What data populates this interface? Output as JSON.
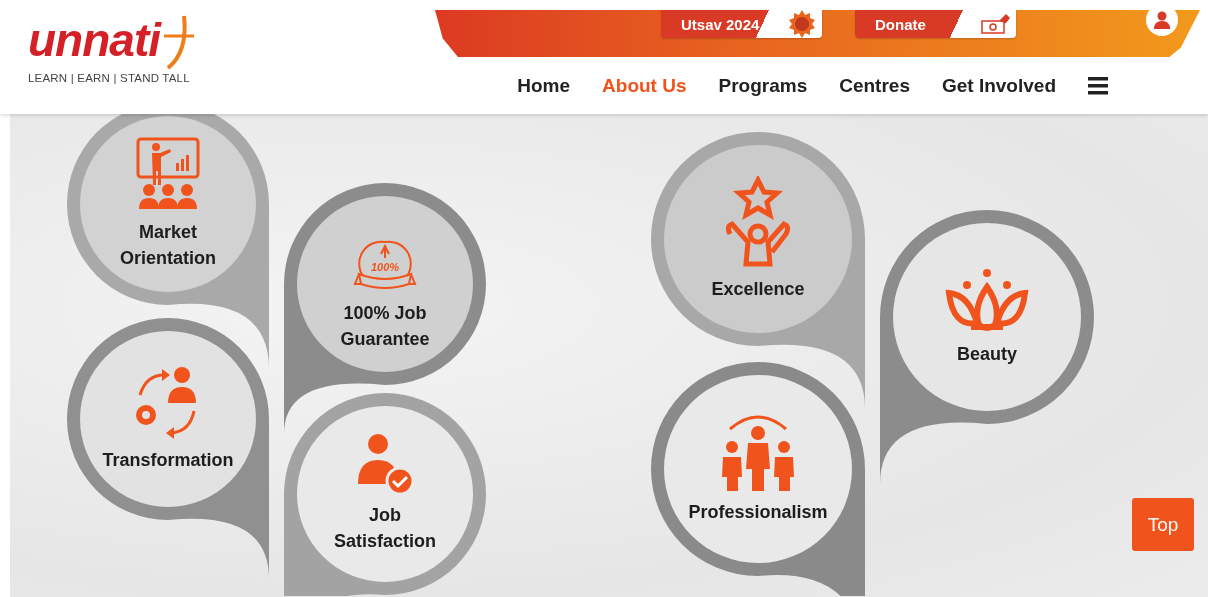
{
  "logo": {
    "wordmark": "unnati",
    "tagline": "LEARN | EARN | STAND TALL"
  },
  "top_bar": {
    "buttons": [
      {
        "label": "Utsav 2024",
        "kind": "badge"
      },
      {
        "label": "Donate",
        "kind": "money"
      }
    ]
  },
  "nav": {
    "items": [
      {
        "label": "Home",
        "selected": false
      },
      {
        "label": "About Us",
        "selected": true
      },
      {
        "label": "Programs",
        "selected": false
      },
      {
        "label": "Centres",
        "selected": false
      },
      {
        "label": "Get Involved",
        "selected": false
      }
    ]
  },
  "values": [
    {
      "label": "Market Orientation",
      "kind": "presenter"
    },
    {
      "label": "100% Job Guarantee",
      "kind": "ribbon",
      "badge_text": "100%"
    },
    {
      "label": "Transformation",
      "kind": "transform"
    },
    {
      "label": "Job Satisfaction",
      "kind": "approved"
    },
    {
      "label": "Excellence",
      "kind": "star"
    },
    {
      "label": "Beauty",
      "kind": "lotus"
    },
    {
      "label": "Professionalism",
      "kind": "team"
    }
  ],
  "scroll_top": {
    "label": "Top"
  }
}
